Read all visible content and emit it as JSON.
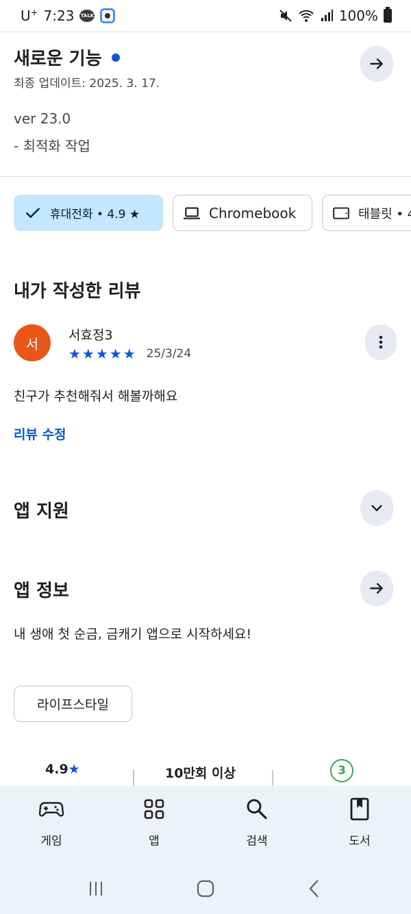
{
  "status_bar": {
    "carrier": "U",
    "carrier_sup": "+",
    "time": "7:23",
    "talk_badge": "TALK",
    "battery": "100%",
    "icons": [
      "kakaotalk-icon",
      "location-app-icon",
      "mute-icon",
      "wifi-icon",
      "signal-icon",
      "battery-icon"
    ]
  },
  "whats_new": {
    "title": "새로운 기능",
    "updated": "최종 업데이트: 2025. 3. 17.",
    "version": "ver 23.0",
    "note": "- 최적화 작업"
  },
  "device_chips": [
    {
      "label": "휴대전화 • 4.9 ★",
      "icon": "check-icon",
      "selected": true
    },
    {
      "label": "Chromebook",
      "icon": "laptop-icon",
      "selected": false
    },
    {
      "label": "태블릿 • 4",
      "icon": "tablet-icon",
      "selected": false
    }
  ],
  "my_review": {
    "heading": "내가 작성한 리뷰",
    "avatar_initial": "서",
    "reviewer": "서효정3",
    "stars": "★★★★★",
    "rating": 5,
    "date": "25/3/24",
    "text": "친구가 추천해줘서 해볼까해요",
    "edit_label": "리뷰 수정"
  },
  "app_support": {
    "title": "앱 지원"
  },
  "app_info": {
    "title": "앱 정보",
    "description": "내 생애 첫 순금, 금캐기 앱으로 시작하세요!",
    "category": "라이프스타일"
  },
  "stats": {
    "rating": "4.9",
    "rating_star": "★",
    "downloads": "10만회 이상",
    "age_rating": "3"
  },
  "bottom_nav": [
    {
      "label": "게임",
      "icon": "gamepad-icon"
    },
    {
      "label": "앱",
      "icon": "apps-grid-icon"
    },
    {
      "label": "검색",
      "icon": "search-icon"
    },
    {
      "label": "도서",
      "icon": "book-icon"
    }
  ],
  "colors": {
    "accent": "#0b57d0",
    "chip_selected": "#c2e7ff",
    "avatar": "#e9561a",
    "age_badge": "#34a853",
    "nav_bg": "#eef1f8"
  }
}
